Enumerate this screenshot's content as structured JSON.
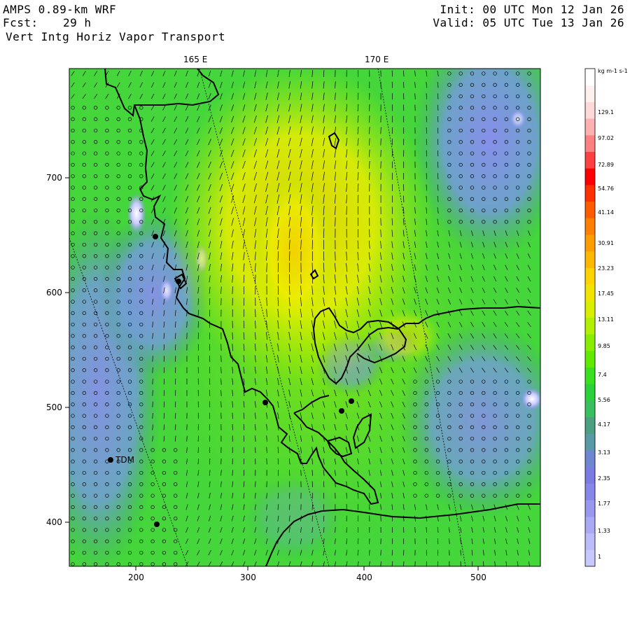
{
  "header": {
    "model": "AMPS 0.89-km WRF",
    "forecast_label": "Fcst:",
    "forecast_hours": "29 h",
    "field": "Vert Intg Horiz Vapor Transport",
    "init": "Init: 00 UTC Mon 12 Jan 26",
    "valid": "Valid: 05 UTC Tue 13 Jan 26"
  },
  "map": {
    "longitude_labels": [
      "165 E",
      "170 E"
    ],
    "x_ticks": [
      "200",
      "300",
      "400",
      "500"
    ],
    "y_ticks": [
      "700",
      "600",
      "500",
      "400"
    ],
    "station_label": "TDM",
    "station_icon": "station-dot-icon"
  },
  "colorbar": {
    "units": "kg m-1 s-1",
    "levels": [
      "129.1",
      "97.02",
      "72.89",
      "54.76",
      "41.14",
      "30.91",
      "23.23",
      "17.45",
      "13.11",
      "9.85",
      "7.4",
      "5.56",
      "4.17",
      "3.13",
      "2.35",
      "1.77",
      "1.33",
      "1"
    ],
    "colors": {
      "high": "#ff0000",
      "mid": "#ffd400",
      "low_mid": "#44dd00",
      "teal": "#4a9a88",
      "low": "#8080f0"
    }
  }
}
